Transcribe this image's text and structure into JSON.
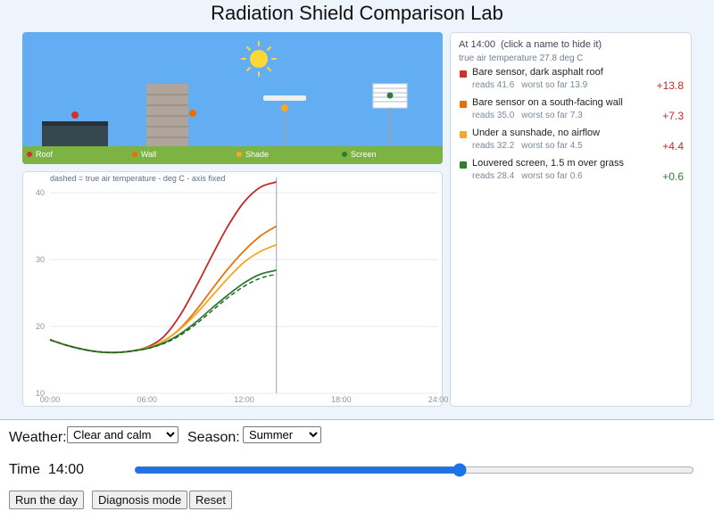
{
  "title": "Radiation Shield Comparison Lab",
  "scene": {
    "labels": [
      {
        "label": "Roof",
        "color": "#d32f2f"
      },
      {
        "label": "Wall",
        "color": "#ef6c00"
      },
      {
        "label": "Shade",
        "color": "#f9a825"
      },
      {
        "label": "Screen",
        "color": "#2e7d32"
      }
    ],
    "sky_color": "#63aef2",
    "grass_color": "#7cb342",
    "sun_color": "#fdd835"
  },
  "readings": {
    "time_label": "At 14:00",
    "hint": "(click a name to hide it)",
    "true_temp": "true air temperature 27.8 deg C",
    "sensors": [
      {
        "name": "Bare sensor, dark asphalt roof",
        "reads": "reads 41.6",
        "worst": "worst so far 13.9",
        "delta": "+13.8",
        "color": "#d32f2f",
        "delta_color": "#c62828"
      },
      {
        "name": "Bare sensor on a south-facing wall",
        "reads": "reads 35.0",
        "worst": "worst so far 7.3",
        "delta": "+7.3",
        "color": "#ef6c00",
        "delta_color": "#c62828"
      },
      {
        "name": "Under a sunshade, no airflow",
        "reads": "reads 32.2",
        "worst": "worst so far 4.5",
        "delta": "+4.4",
        "color": "#f9a825",
        "delta_color": "#c62828"
      },
      {
        "name": "Louvered screen, 1.5 m over grass",
        "reads": "reads 28.4",
        "worst": "worst so far 0.6",
        "delta": "+0.6",
        "color": "#2e7d32",
        "delta_color": "#2e7d32"
      }
    ]
  },
  "chart_data": {
    "type": "line",
    "title": "dashed = true air temperature   -   deg C   -   axis fixed",
    "xlabel": "",
    "ylabel": "",
    "x_ticks": [
      "00:00",
      "06:00",
      "12:00",
      "18:00",
      "24:00"
    ],
    "y_ticks": [
      10,
      20,
      30,
      40
    ],
    "xlim": [
      0,
      24
    ],
    "ylim": [
      10,
      42
    ],
    "current_hour": 14,
    "grid": true,
    "x": [
      0,
      1,
      2,
      3,
      4,
      5,
      6,
      7,
      8,
      9,
      10,
      11,
      12,
      13,
      14
    ],
    "series": [
      {
        "name": "Bare sensor, dark asphalt roof",
        "color": "#c62828",
        "dashed": false,
        "values": [
          18.0,
          17.2,
          16.6,
          16.2,
          16.1,
          16.3,
          16.9,
          18.4,
          21.5,
          25.8,
          30.5,
          35.0,
          38.6,
          40.8,
          41.6
        ]
      },
      {
        "name": "Bare sensor on a south-facing wall",
        "color": "#e8740c",
        "dashed": false,
        "values": [
          18.0,
          17.2,
          16.6,
          16.2,
          16.1,
          16.3,
          16.8,
          17.8,
          19.6,
          22.3,
          25.5,
          28.6,
          31.3,
          33.5,
          35.0
        ]
      },
      {
        "name": "Under a sunshade, no airflow",
        "color": "#f5a623",
        "dashed": false,
        "values": [
          18.0,
          17.2,
          16.6,
          16.2,
          16.1,
          16.3,
          16.8,
          17.8,
          19.5,
          21.8,
          24.5,
          27.2,
          29.6,
          31.2,
          32.2
        ]
      },
      {
        "name": "Louvered screen, 1.5 m over grass",
        "color": "#2e7d32",
        "dashed": false,
        "values": [
          18.0,
          17.2,
          16.6,
          16.2,
          16.1,
          16.3,
          16.7,
          17.5,
          18.8,
          20.6,
          22.7,
          24.7,
          26.5,
          27.8,
          28.4
        ]
      },
      {
        "name": "true air temperature",
        "color": "#1b5e20",
        "dashed": true,
        "values": [
          18.0,
          17.2,
          16.6,
          16.2,
          16.1,
          16.3,
          16.7,
          17.4,
          18.6,
          20.3,
          22.3,
          24.3,
          26.0,
          27.2,
          27.8
        ]
      }
    ]
  },
  "controls": {
    "weather_label": "Weather:",
    "weather_selected": "Clear and calm",
    "season_label": "Season:",
    "season_selected": "Summer",
    "time_label": "Time",
    "time_value": "14:00",
    "time_fraction": 0.583,
    "buttons": {
      "run": "Run the day",
      "diagnosis": "Diagnosis mode",
      "reset": "Reset"
    }
  }
}
